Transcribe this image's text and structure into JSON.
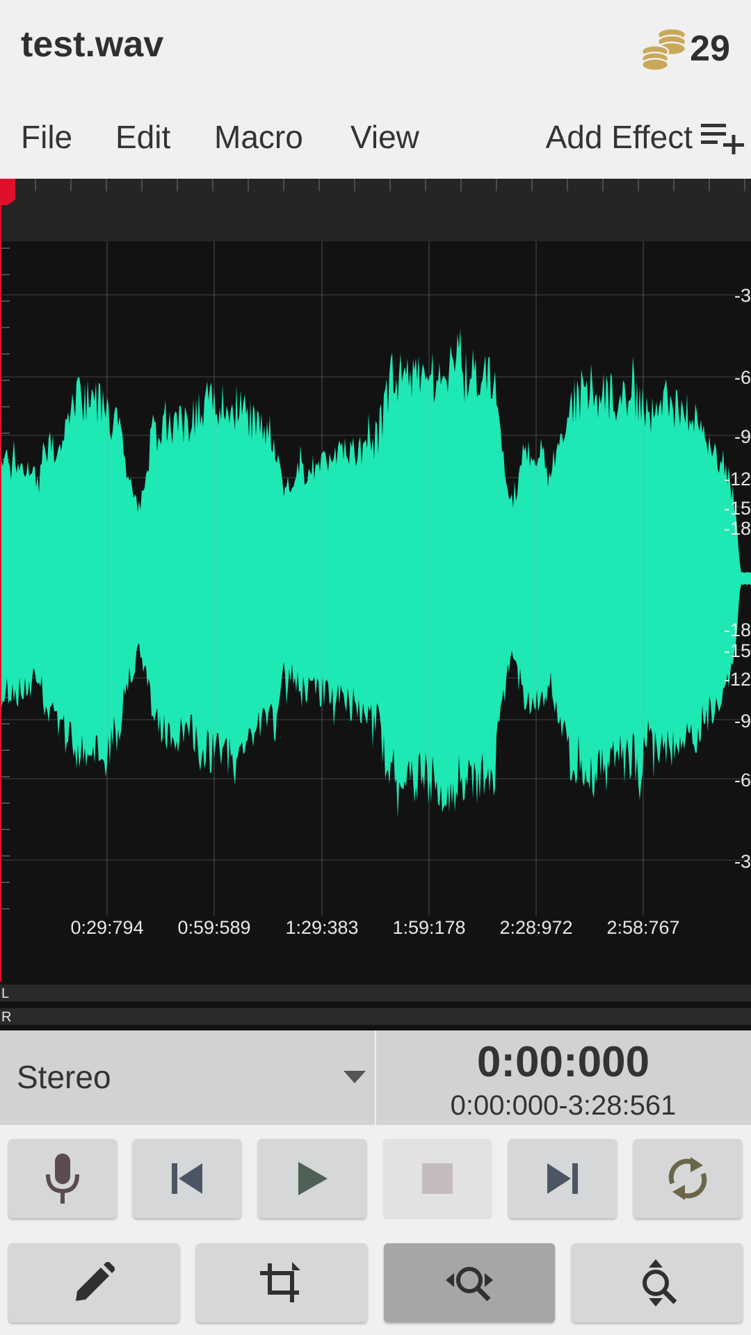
{
  "header": {
    "title": "test.wav",
    "coins": "29",
    "coin_icon": "coins-icon"
  },
  "menu": {
    "items": [
      "File",
      "Edit",
      "Macro",
      "View"
    ],
    "add_effect": "Add Effect",
    "add_effect_icon": "playlist-add-icon"
  },
  "waveform": {
    "colors": {
      "wave": "#1ee8b4",
      "background": "#121212",
      "playhead": "#e0102a"
    },
    "db_labels": [
      "-3",
      "-6",
      "-9",
      "-12",
      "-15",
      "-18",
      "-18",
      "-15",
      "-12",
      "-9",
      "-6",
      "-3"
    ],
    "time_labels": [
      "0:29:794",
      "0:59:589",
      "1:29:383",
      "1:59:178",
      "2:28:972",
      "2:58:767"
    ],
    "channel_labels": [
      "L",
      "R"
    ]
  },
  "info": {
    "channel_mode": "Stereo",
    "time_current": "0:00:000",
    "time_range": "0:00:000-3:28:561"
  },
  "transport": {
    "icons": [
      "microphone-icon",
      "skip-previous-icon",
      "play-icon",
      "stop-icon",
      "skip-next-icon",
      "loop-icon"
    ]
  },
  "tools": {
    "icons": [
      "pencil-icon",
      "crop-icon",
      "zoom-horizontal-icon",
      "zoom-vertical-icon"
    ]
  }
}
